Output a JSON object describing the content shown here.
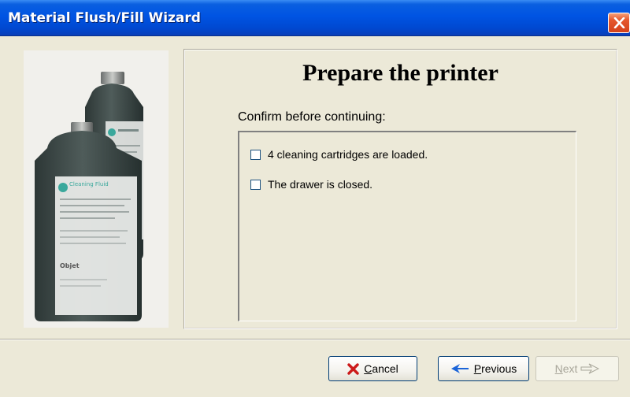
{
  "window": {
    "title": "Material Flush/Fill Wizard"
  },
  "title_bar": {
    "close_icon": "close-x-icon"
  },
  "image_panel": {
    "graphic": "cleaning-fluid-bottles",
    "label_text": "Cleaning Fluid",
    "logo_text": "Objet"
  },
  "main": {
    "heading": "Prepare the printer",
    "instruction": "Confirm before continuing:",
    "checklist": [
      {
        "label": "4 cleaning cartridges are loaded.",
        "checked": false
      },
      {
        "label": "The drawer is closed.",
        "checked": false
      }
    ]
  },
  "buttons": {
    "cancel": {
      "hotkey": "C",
      "rest": "ancel",
      "icon": "red-x-icon"
    },
    "previous": {
      "hotkey": "P",
      "rest": "revious",
      "icon": "blue-left-arrow-icon"
    },
    "next": {
      "hotkey": "N",
      "rest": "ext",
      "icon": "right-arrow-outline-icon",
      "enabled": false
    }
  },
  "colors": {
    "titlebar": "#0054e3",
    "dialog_bg": "#ece9d8",
    "close_button": "#e5582d",
    "cancel_icon": "#cc1a1a",
    "previous_icon": "#1b64d8"
  }
}
